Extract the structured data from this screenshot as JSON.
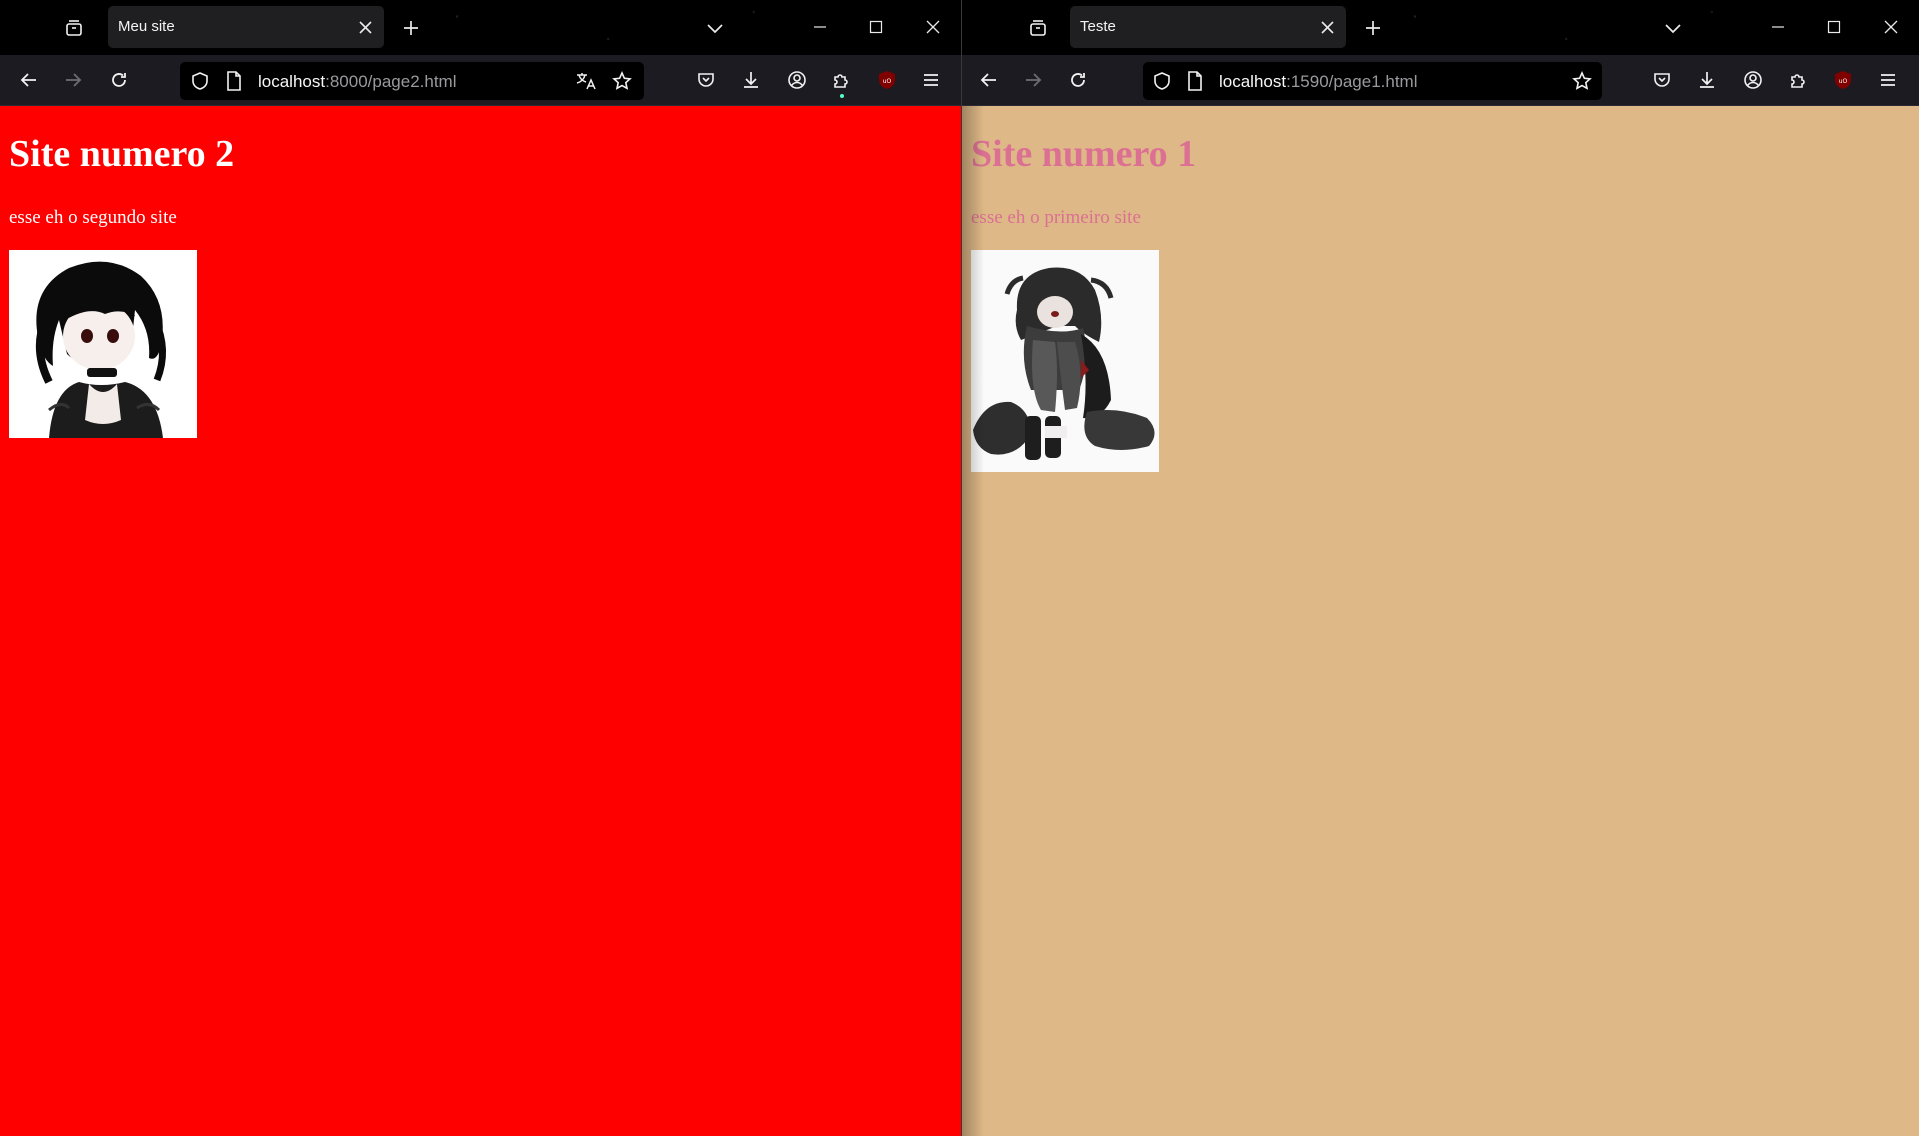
{
  "left_window": {
    "tab_title": "Meu site",
    "url_host": "localhost",
    "url_rest": ":8000/page2.html",
    "page": {
      "heading": "Site numero 2",
      "paragraph": "esse eh o segundo site",
      "background": "#ff0000",
      "text_color": "#ffffff",
      "image": "anime-girl-portrait"
    }
  },
  "right_window": {
    "tab_title": "Teste",
    "url_host": "localhost",
    "url_rest": ":1590/page1.html",
    "page": {
      "heading": "Site numero 1",
      "paragraph": "esse eh o primeiro site",
      "background": "#deb887",
      "text_color": "#db7093",
      "image": "anime-girl-sitting"
    }
  },
  "icons": {
    "tab_manager": "tab-manager-icon",
    "close_tab": "close-icon",
    "new_tab": "plus-icon",
    "list_all_tabs": "chevron-down-icon",
    "minimize": "minimize-icon",
    "maximize": "maximize-icon",
    "close_window": "close-icon",
    "back": "arrow-left-icon",
    "forward": "arrow-right-icon",
    "reload": "reload-icon",
    "tracking_protection": "shield-icon",
    "page_info": "page-icon",
    "translate": "translate-icon",
    "bookmark": "star-icon",
    "pocket": "pocket-icon",
    "downloads": "download-icon",
    "account": "account-icon",
    "extensions": "puzzle-icon",
    "ublock": "ublock-origin-icon",
    "menu": "hamburger-menu-icon"
  },
  "theme": {
    "chrome_bg": "#000000",
    "toolbar_bg": "#1c1b22",
    "active_tab_bg": "#1f1f22",
    "accent_green": "#54ffbd",
    "ublock_red": "#800000"
  }
}
